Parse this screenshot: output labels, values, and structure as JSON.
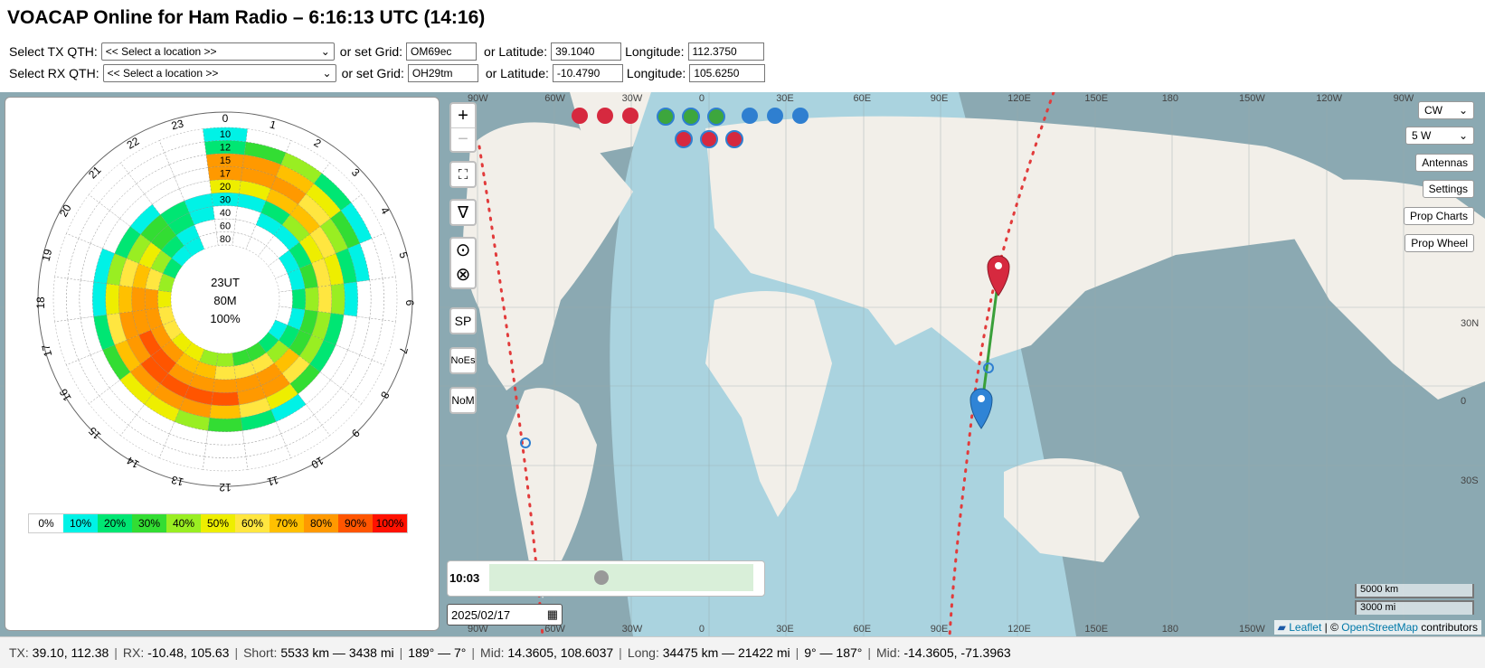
{
  "header": {
    "title": "VOACAP Online for Ham Radio – 6:16:13 UTC (14:16)",
    "tx": {
      "label": "Select TX QTH:",
      "location": "<< Select a location >>",
      "grid_label": "or set Grid:",
      "grid": "OM69ec",
      "lat_label": "or Latitude:",
      "lat": "39.1040",
      "lon_label": "Longitude:",
      "lon": "112.3750"
    },
    "rx": {
      "label": "Select RX QTH:",
      "location": "<< Select a location >>",
      "grid_label": "or set Grid:",
      "grid": "OH29tm",
      "lat_label": "or Latitude:",
      "lat": "-10.4790",
      "lon_label": "Longitude:",
      "lon": "105.6250"
    }
  },
  "map": {
    "top_lon_labels": [
      "90W",
      "60W",
      "30W",
      "0",
      "30E",
      "60E",
      "90E",
      "120E",
      "150E",
      "180",
      "150W",
      "120W",
      "90W"
    ],
    "bottom_lon_labels": [
      "90W",
      "60W",
      "30W",
      "0",
      "30E",
      "60E",
      "90E",
      "120E",
      "150E",
      "180",
      "150W"
    ],
    "lat_labels": [
      "30N",
      "0",
      "30S"
    ],
    "controls": {
      "zoom_in": "+",
      "zoom_out": "−",
      "sp": "SP",
      "noes": "NoEs",
      "nom": "NoM"
    },
    "right_controls": {
      "mode": "CW",
      "power": "5 W",
      "antennas": "Antennas",
      "settings": "Settings",
      "prop_charts": "Prop Charts",
      "prop_wheel": "Prop Wheel"
    },
    "time": "10:03",
    "date": "2025/02/17",
    "scale": [
      "5000 km",
      "3000 mi"
    ],
    "attribution": {
      "leaflet": "Leaflet",
      "sep": " | © ",
      "osm": "OpenStreetMap",
      "rest": " contributors"
    },
    "dots_row1": [
      "#d6293f",
      "#d6293f",
      "#d6293f",
      "#3da63d",
      "#3da63d",
      "#3da63d",
      "#2f7fd0",
      "#2f7fd0",
      "#2f7fd0"
    ],
    "dots_row2": [
      "#d6293f",
      "#d6293f",
      "#d6293f"
    ]
  },
  "wheel": {
    "center": [
      "23UT",
      "80M",
      "100%"
    ],
    "hours": [
      "0",
      "1",
      "2",
      "3",
      "4",
      "5",
      "6",
      "7",
      "8",
      "9",
      "10",
      "11",
      "12",
      "13",
      "14",
      "15",
      "16",
      "17",
      "18",
      "19",
      "20",
      "21",
      "22",
      "23"
    ],
    "bands": [
      "10",
      "12",
      "15",
      "17",
      "20",
      "30",
      "40",
      "60",
      "80"
    ],
    "legend": [
      "0%",
      "10%",
      "20%",
      "30%",
      "40%",
      "50%",
      "60%",
      "70%",
      "80%",
      "90%",
      "100%"
    ],
    "legend_colors": [
      "#ffffff",
      "#00f2e6",
      "#00e673",
      "#33dd33",
      "#99ee22",
      "#eeee00",
      "#ffe640",
      "#ffc000",
      "#ff9900",
      "#ff5500",
      "#ff1100"
    ],
    "grid": [
      [
        1,
        0,
        0,
        0,
        0,
        0,
        0,
        0,
        0,
        0,
        0,
        0,
        0,
        0,
        0,
        0,
        0,
        0,
        0,
        0,
        0,
        0,
        0,
        0
      ],
      [
        2,
        3,
        4,
        2,
        1,
        0,
        0,
        0,
        0,
        0,
        0,
        0,
        0,
        0,
        0,
        0,
        0,
        0,
        0,
        0,
        0,
        0,
        0,
        0
      ],
      [
        8,
        8,
        7,
        5,
        3,
        1,
        0,
        0,
        0,
        0,
        0,
        0,
        0,
        0,
        0,
        0,
        0,
        0,
        0,
        0,
        0,
        0,
        0,
        0
      ],
      [
        8,
        8,
        8,
        6,
        4,
        2,
        1,
        0,
        0,
        0,
        1,
        2,
        3,
        4,
        5,
        5,
        3,
        2,
        1,
        1,
        0,
        0,
        0,
        0
      ],
      [
        5,
        5,
        7,
        7,
        6,
        5,
        4,
        2,
        2,
        3,
        5,
        6,
        7,
        8,
        8,
        8,
        7,
        6,
        5,
        4,
        2,
        1,
        0,
        0
      ],
      [
        1,
        1,
        2,
        4,
        5,
        6,
        6,
        4,
        4,
        6,
        8,
        8,
        9,
        9,
        9,
        9,
        8,
        8,
        7,
        6,
        4,
        3,
        2,
        1
      ],
      [
        0,
        0,
        1,
        1,
        2,
        3,
        4,
        3,
        3,
        7,
        8,
        8,
        8,
        8,
        8,
        9,
        9,
        8,
        8,
        7,
        5,
        3,
        2,
        1
      ],
      [
        0,
        0,
        0,
        0,
        1,
        1,
        2,
        1,
        2,
        4,
        6,
        6,
        6,
        7,
        7,
        8,
        8,
        8,
        8,
        6,
        4,
        2,
        1,
        0
      ],
      [
        0,
        0,
        0,
        0,
        0,
        0,
        0,
        0,
        1,
        2,
        3,
        3,
        4,
        4,
        5,
        5,
        6,
        6,
        5,
        4,
        2,
        1,
        1,
        0
      ]
    ]
  },
  "status": {
    "tx_label": "TX:",
    "tx": "39.10, 112.38",
    "rx_label": "RX:",
    "rx": "-10.48, 105.63",
    "short_label": "Short:",
    "short": "5533 km — 3438 mi",
    "short_bearing": "189° — 7°",
    "mid_label": "Mid:",
    "mid": "14.3605, 108.6037",
    "long_label": "Long:",
    "long": "34475 km — 21422 mi",
    "long_bearing": "9° — 187°",
    "mid2_label": "Mid:",
    "mid2": "-14.3605, -71.3963"
  }
}
